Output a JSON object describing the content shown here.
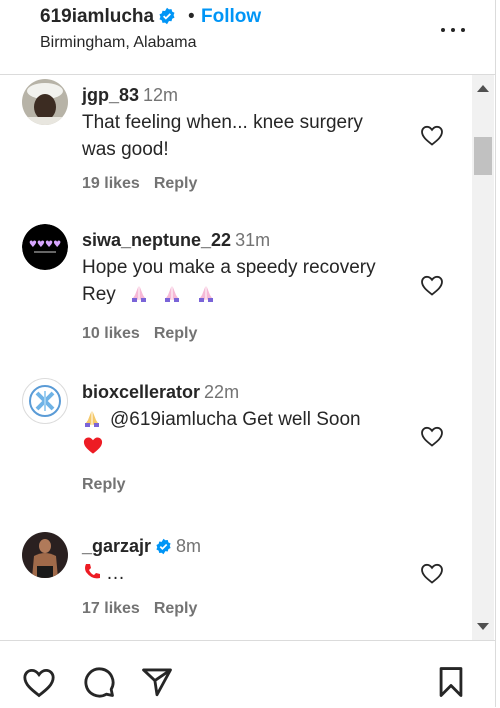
{
  "header": {
    "username": "619iamlucha",
    "separator": "•",
    "follow_label": "Follow",
    "location": "Birmingham, Alabama"
  },
  "comments": [
    {
      "username": "jgp_83",
      "time": "12m",
      "text_line1": "That feeling when... knee surgery",
      "text_line2": "was good!",
      "likes": "19 likes",
      "reply": "Reply"
    },
    {
      "username": "siwa_neptune_22",
      "time": "31m",
      "text_line1": "Hope you make a speedy recovery",
      "text_line2": "Rey",
      "likes": "10 likes",
      "reply": "Reply"
    },
    {
      "username": "bioxcellerator",
      "time": "22m",
      "mention": "@619iamlucha",
      "text_after_mention": " Get well Soon",
      "reply": "Reply"
    },
    {
      "username": "_garzajr",
      "time": "8m",
      "text": "…",
      "likes": "17 likes",
      "reply": "Reply"
    }
  ],
  "colors": {
    "accent": "#0095f6",
    "verified": "#0095f6",
    "heart_red": "#ed1c24"
  }
}
